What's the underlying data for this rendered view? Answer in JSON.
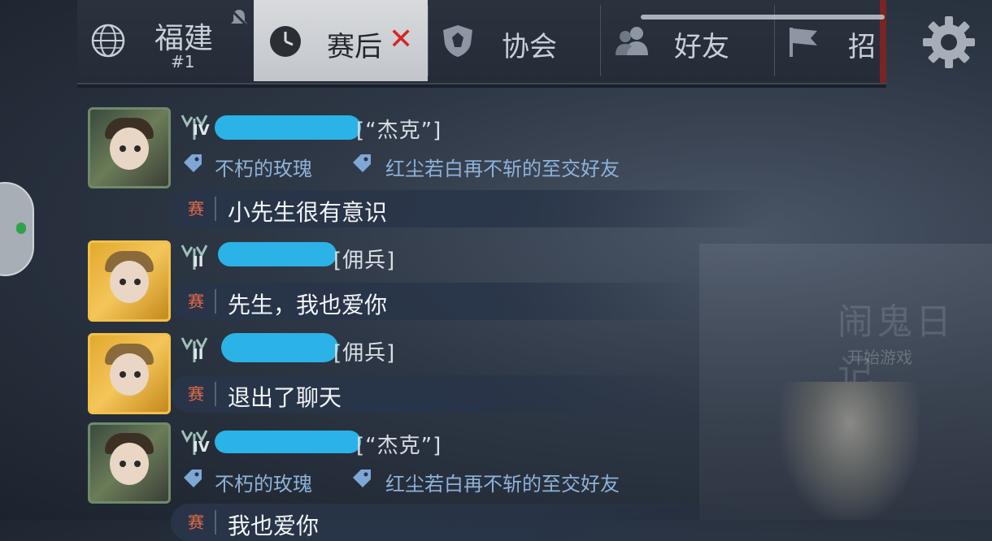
{
  "topbar": {
    "region": {
      "name": "福建",
      "rank": "#1"
    },
    "tabs": [
      {
        "label": "赛后",
        "active": true
      },
      {
        "label": "协会",
        "active": false
      },
      {
        "label": "好友",
        "active": false
      },
      {
        "label": "招",
        "active": false
      }
    ]
  },
  "background": {
    "title": "闹鬼日记",
    "subtitle": "开始游戏"
  },
  "messages": [
    {
      "rank": "IV",
      "name_prefix": "",
      "name_suffix": "",
      "role": "[“杰克”]",
      "tags": [
        "不朽的玫瑰",
        "红尘若白再不斩的至交好友"
      ],
      "channel": "赛",
      "text": "小先生很有意识"
    },
    {
      "rank": "II",
      "name_prefix": "",
      "name_suffix": "",
      "role": "[佣兵]",
      "tags": [],
      "channel": "赛",
      "text": "先生，我也爱你"
    },
    {
      "rank": "II",
      "name_prefix": "",
      "name_suffix": "",
      "role": "[佣兵]",
      "tags": [],
      "channel": "赛",
      "text": "退出了聊天"
    },
    {
      "rank": "IV",
      "name_prefix": "",
      "name_suffix": "",
      "role": "[“杰克”]",
      "tags": [
        "不朽的玫瑰",
        "红尘若白再不斩的至交好友"
      ],
      "channel": "赛",
      "text": "我也爱你"
    }
  ],
  "colors": {
    "accent_red": "#d42626",
    "name_blur": "#2bb2e6",
    "tag_text": "#8fb2d8",
    "channel_badge": "#e56b48"
  }
}
